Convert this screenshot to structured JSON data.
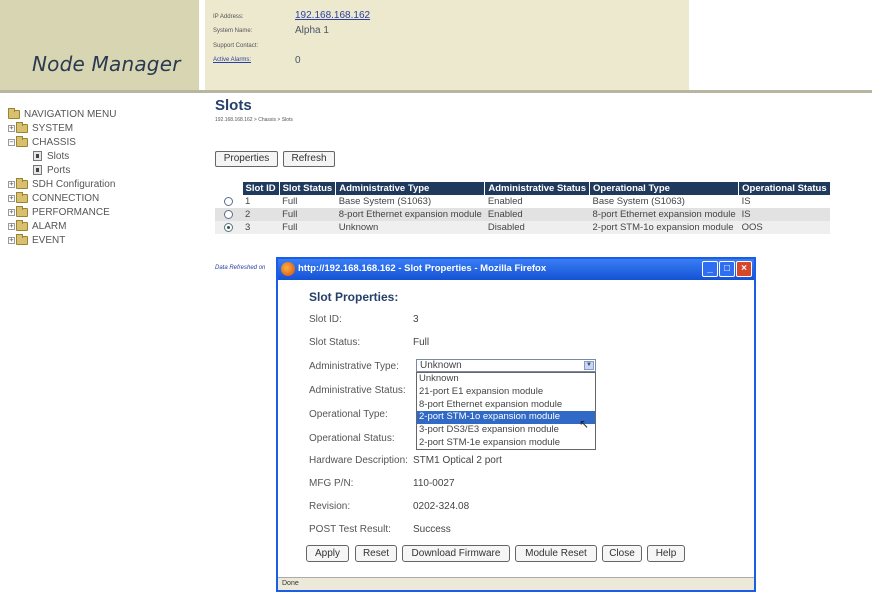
{
  "header": {
    "app_title": "Node Manager",
    "info": [
      {
        "label": "IP Address:",
        "value": "192.168.168.162",
        "link": true
      },
      {
        "label": "System Name:",
        "value": "Alpha 1",
        "link": false
      },
      {
        "label": "Support Contact:",
        "value": "",
        "link": false
      },
      {
        "label": "Active Alarms:",
        "value": "0",
        "link": false
      }
    ]
  },
  "nav": {
    "items": [
      {
        "label": "NAVIGATION MENU",
        "icon": "folder-icon"
      },
      {
        "label": "SYSTEM",
        "icon": "folder-icon"
      },
      {
        "label": "CHASSIS",
        "icon": "folder-open-icon"
      },
      {
        "label": "Slots",
        "icon": "page-icon"
      },
      {
        "label": "Ports",
        "icon": "page-icon"
      },
      {
        "label": "SDH Configuration",
        "icon": "folder-icon"
      },
      {
        "label": "CONNECTION",
        "icon": "folder-icon"
      },
      {
        "label": "PERFORMANCE",
        "icon": "folder-icon"
      },
      {
        "label": "ALARM",
        "icon": "folder-icon"
      },
      {
        "label": "EVENT",
        "icon": "folder-icon"
      }
    ]
  },
  "main": {
    "title": "Slots",
    "breadcrumb": "192.168.168.162 > Chassis > Slots",
    "buttons": {
      "properties": "Properties",
      "refresh": "Refresh"
    },
    "columns": [
      "Slot ID",
      "Slot Status",
      "Administrative Type",
      "Administrative Status",
      "Operational Type",
      "Operational Status"
    ],
    "rows": [
      {
        "selected": false,
        "slot_id": "1",
        "slot_status": "Full",
        "admin_type": "Base System (S1063)",
        "admin_status": "Enabled",
        "op_type": "Base System (S1063)",
        "op_status": "IS"
      },
      {
        "selected": false,
        "slot_id": "2",
        "slot_status": "Full",
        "admin_type": "8-port Ethernet expansion module",
        "admin_status": "Enabled",
        "op_type": "8-port Ethernet expansion module",
        "op_status": "IS"
      },
      {
        "selected": true,
        "slot_id": "3",
        "slot_status": "Full",
        "admin_type": "Unknown",
        "admin_status": "Disabled",
        "op_type": "2-port STM-1o expansion module",
        "op_status": "OOS"
      }
    ],
    "refreshed_text": "Data Refreshed on"
  },
  "popup": {
    "window_title": "http://192.168.168.162 - Slot Properties - Mozilla Firefox",
    "heading": "Slot Properties:",
    "fields": {
      "slot_id": {
        "label": "Slot ID:",
        "value": "3"
      },
      "slot_status": {
        "label": "Slot Status:",
        "value": "Full"
      },
      "admin_type": {
        "label": "Administrative Type:",
        "value": "Unknown"
      },
      "admin_status": {
        "label": "Administrative Status:"
      },
      "op_type": {
        "label": "Operational Type:"
      },
      "op_status": {
        "label": "Operational Status:"
      },
      "hw_desc": {
        "label": "Hardware Description:",
        "value": "STM1 Optical 2 port"
      },
      "mfg_pn": {
        "label": "MFG P/N:",
        "value": "110-0027"
      },
      "revision": {
        "label": "Revision:",
        "value": "0202-324.08"
      },
      "post": {
        "label": "POST Test Result:",
        "value": "Success"
      }
    },
    "dropdown_options": [
      "Unknown",
      "21-port E1 expansion module",
      "8-port Ethernet expansion module",
      "2-port STM-1o expansion module",
      "3-port DS3/E3 expansion module",
      "2-port STM-1e expansion module"
    ],
    "highlighted_option_index": 3,
    "buttons": {
      "apply": "Apply",
      "reset": "Reset",
      "download": "Download Firmware",
      "module_reset": "Module Reset",
      "close": "Close",
      "help": "Help"
    },
    "status": "Done"
  },
  "colors": {
    "table_header": "#1f3a5c",
    "window_titlebar": "#1452d4",
    "highlight": "#3169c6",
    "logo_bg": "#d8d5b2"
  }
}
